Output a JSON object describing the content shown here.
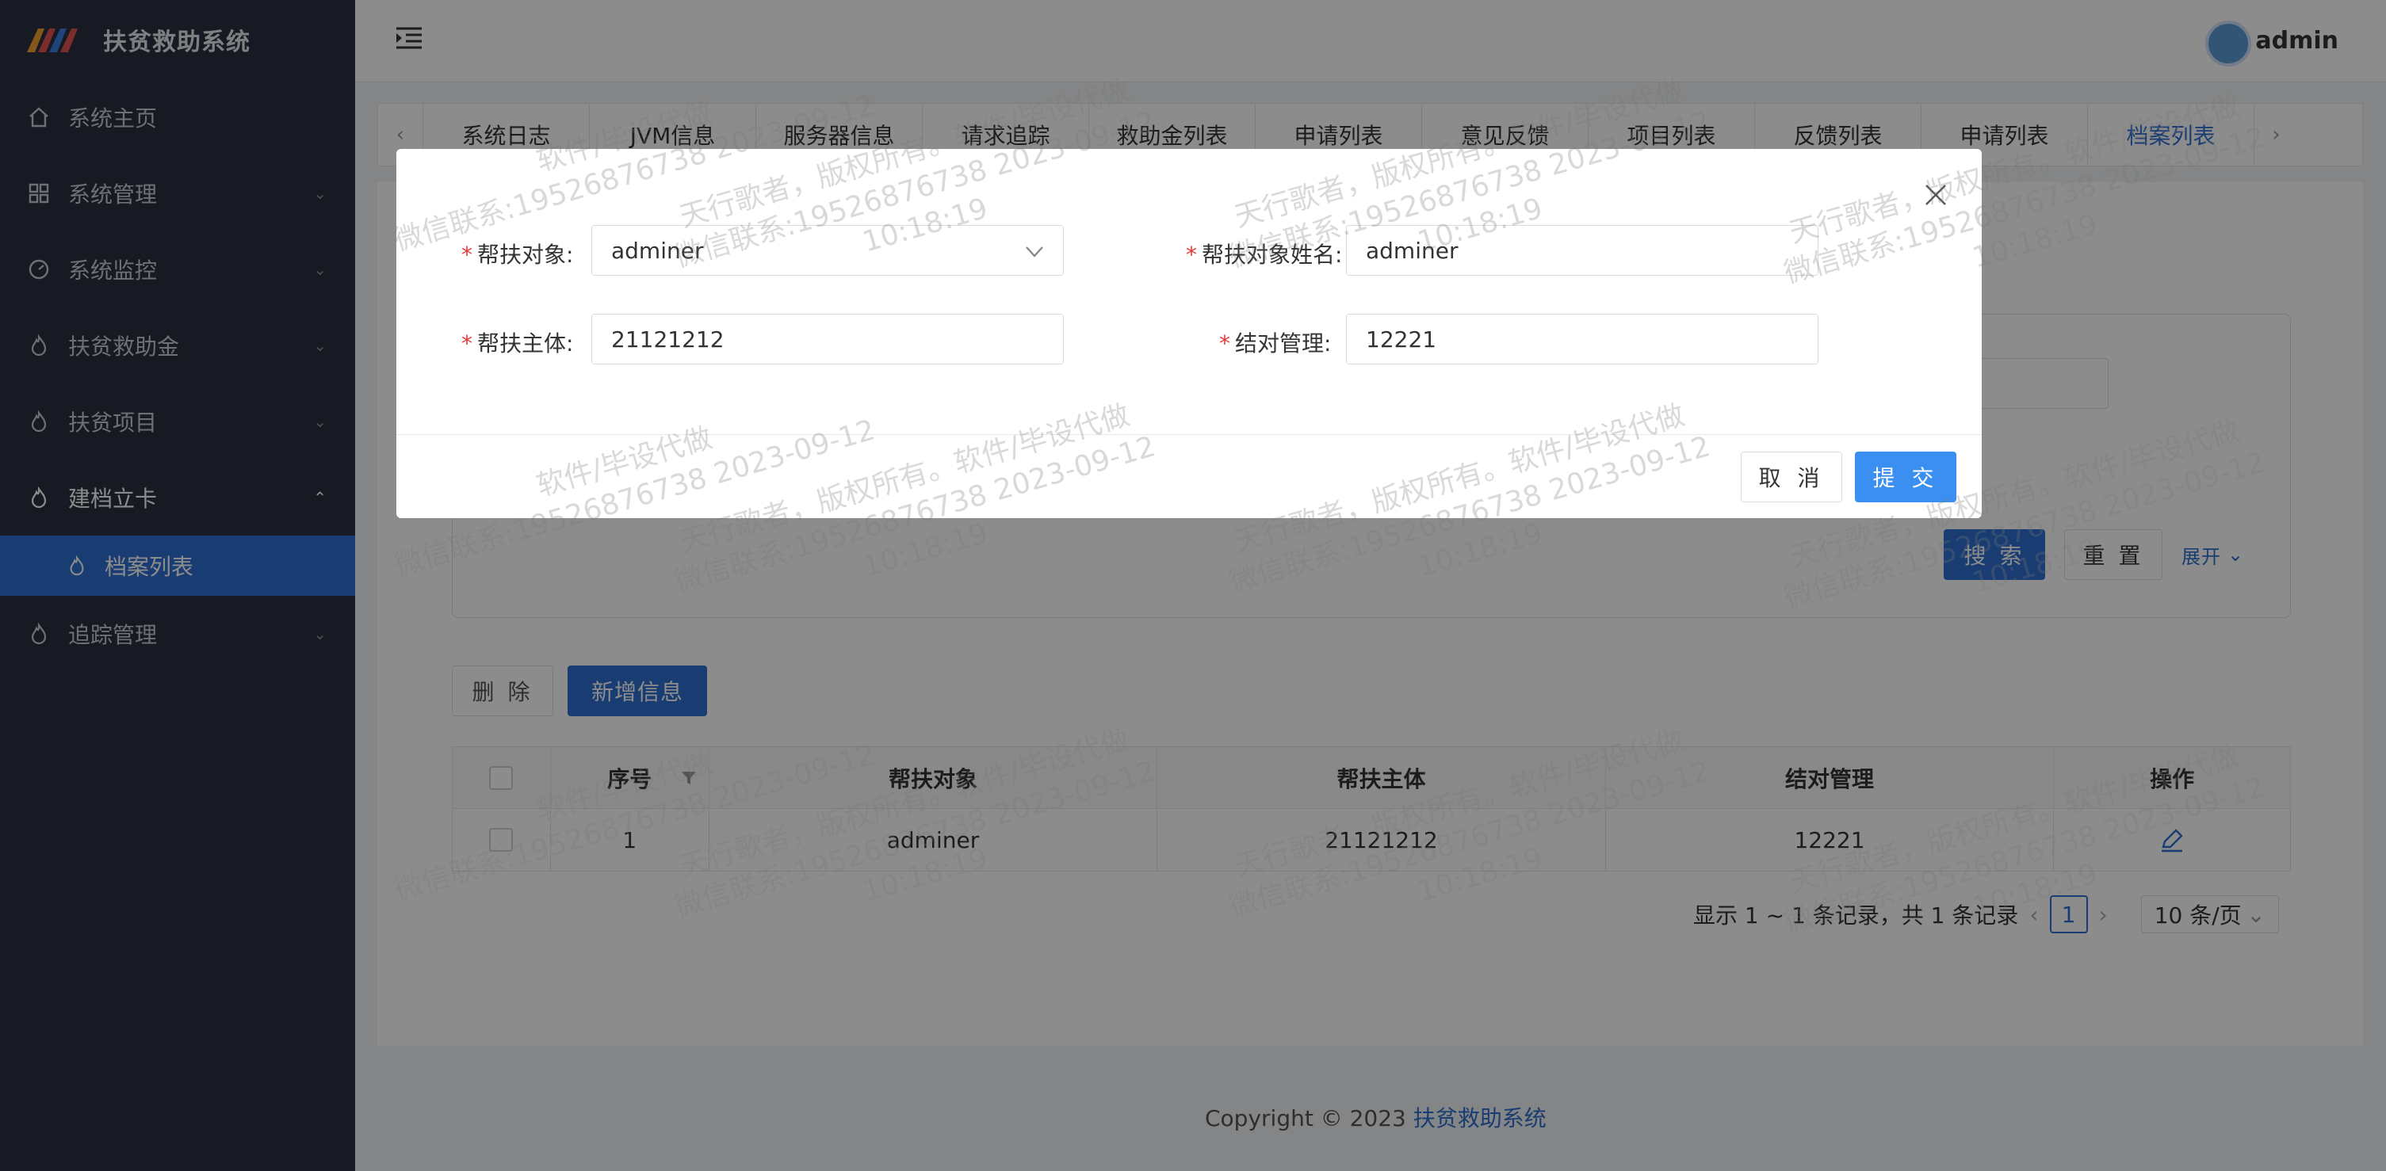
{
  "app": {
    "title": "扶贫救助系统"
  },
  "header": {
    "user": "admin"
  },
  "sidebar": {
    "items": [
      {
        "label": "系统主页",
        "icon": "home-icon"
      },
      {
        "label": "系统管理",
        "icon": "grid-icon"
      },
      {
        "label": "系统监控",
        "icon": "dashboard-icon"
      },
      {
        "label": "扶贫救助金",
        "icon": "fire-icon"
      },
      {
        "label": "扶贫项目",
        "icon": "fire-icon"
      },
      {
        "label": "建档立卡",
        "icon": "fire-icon"
      },
      {
        "label": "追踪管理",
        "icon": "fire-icon"
      }
    ],
    "sub_active": "档案列表"
  },
  "tabs": [
    "系统日志",
    "JVM信息",
    "服务器信息",
    "请求追踪",
    "救助金列表",
    "申请列表",
    "意见反馈",
    "项目列表",
    "反馈列表",
    "申请列表",
    "档案列表"
  ],
  "search": {
    "search_label": "搜 索",
    "reset_label": "重 置",
    "expand_label": "展开"
  },
  "actions": {
    "delete_label": "删 除",
    "add_label": "新增信息"
  },
  "table": {
    "headers": [
      "序号",
      "帮扶对象",
      "帮扶主体",
      "结对管理",
      "操作"
    ],
    "rows": [
      {
        "index": "1",
        "object": "adminer",
        "subject": "21121212",
        "pair": "12221"
      }
    ]
  },
  "pagination": {
    "summary": "显示 1 ~ 1 条记录，共 1 条记录",
    "current": "1",
    "page_size": "10 条/页"
  },
  "footer": {
    "prefix": "Copyright © 2023",
    "link": "扶贫救助系统"
  },
  "modal": {
    "fields": {
      "object_label": "帮扶对象:",
      "object_value": "adminer",
      "object_name_label": "帮扶对象姓名:",
      "object_name_value": "adminer",
      "subject_label": "帮扶主体:",
      "subject_value": "21121212",
      "pair_label": "结对管理:",
      "pair_value": "12221"
    },
    "cancel_label": "取 消",
    "submit_label": "提 交"
  },
  "watermark": {
    "line1": "软件/毕设代做",
    "line2": "天行歌者，版权所有。软件/毕设代做",
    "line3": "微信联系:19526876738 2023-09-12",
    "line4": "10:18:19"
  },
  "colors": {
    "accent": "#2f6fd0",
    "sidebar": "#2b3140",
    "required": "#e53935"
  }
}
